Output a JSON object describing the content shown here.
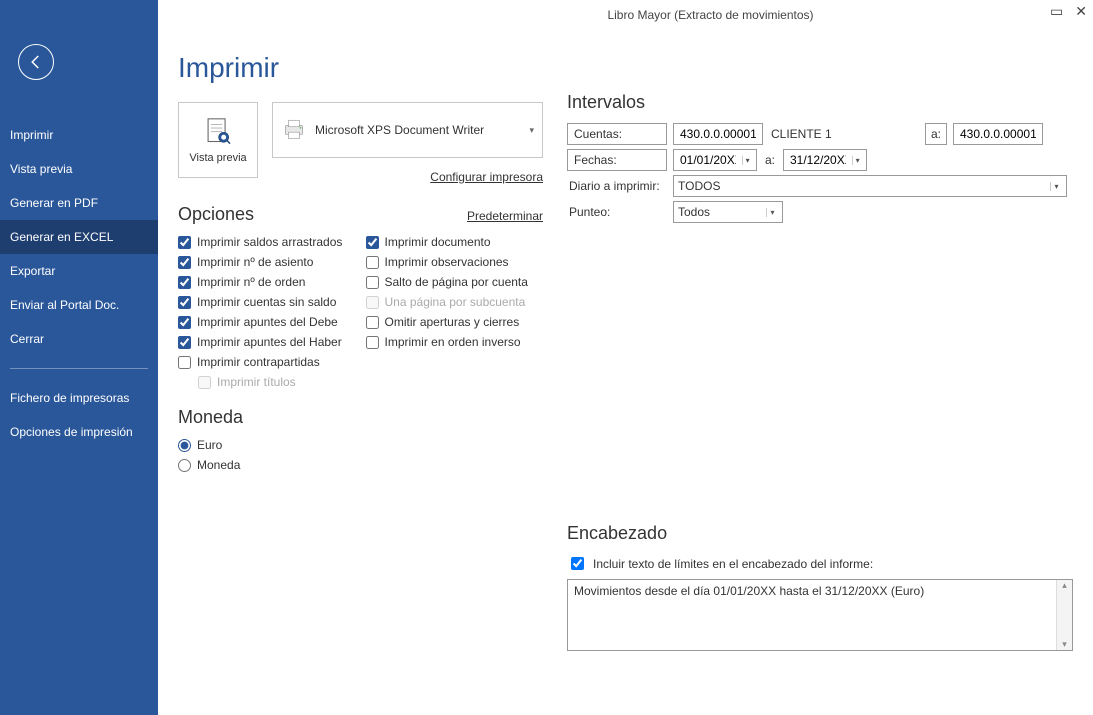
{
  "window": {
    "title": "Libro Mayor (Extracto de movimientos)"
  },
  "sidebar": {
    "items": [
      {
        "label": "Imprimir"
      },
      {
        "label": "Vista previa"
      },
      {
        "label": "Generar en PDF"
      },
      {
        "label": "Generar en EXCEL",
        "selected": true
      },
      {
        "label": "Exportar"
      },
      {
        "label": "Enviar al Portal Doc."
      },
      {
        "label": "Cerrar"
      }
    ],
    "items2": [
      {
        "label": "Fichero de impresoras"
      },
      {
        "label": "Opciones de impresión"
      }
    ]
  },
  "page": {
    "title": "Imprimir",
    "previewLabel": "Vista previa",
    "printerName": "Microsoft XPS Document Writer",
    "configurePrinter": "Configurar impresora",
    "optionsTitle": "Opciones",
    "defaultLink": "Predeterminar"
  },
  "options": {
    "left": [
      {
        "label": "Imprimir saldos arrastrados",
        "checked": true
      },
      {
        "label": "Imprimir nº de asiento",
        "checked": true
      },
      {
        "label": "Imprimir nº de orden",
        "checked": true
      },
      {
        "label": "Imprimir cuentas sin saldo",
        "checked": true
      },
      {
        "label": "Imprimir apuntes del Debe",
        "checked": true
      },
      {
        "label": "Imprimir apuntes del Haber",
        "checked": true
      },
      {
        "label": "Imprimir contrapartidas",
        "checked": false
      },
      {
        "label": "Imprimir títulos",
        "checked": false,
        "disabled": true,
        "indent": true
      }
    ],
    "right": [
      {
        "label": "Imprimir documento",
        "checked": true
      },
      {
        "label": "Imprimir observaciones",
        "checked": false
      },
      {
        "label": "Salto de página por cuenta",
        "checked": false
      },
      {
        "label": "Una página por subcuenta",
        "checked": false,
        "disabled": true
      },
      {
        "label": "Omitir aperturas y cierres",
        "checked": false
      },
      {
        "label": "Imprimir en orden inverso",
        "checked": false
      }
    ]
  },
  "moneda": {
    "title": "Moneda",
    "options": [
      {
        "label": "Euro",
        "checked": true
      },
      {
        "label": "Moneda",
        "checked": false
      }
    ]
  },
  "intervalos": {
    "title": "Intervalos",
    "cuentasLabel": "Cuentas:",
    "cuentaFrom": "430.0.0.00001",
    "cuentaFromName": "CLIENTE 1",
    "aLabel": "a:",
    "cuentaTo": "430.0.0.00001",
    "fechasLabel": "Fechas:",
    "fechaFrom": "01/01/20XX",
    "fechaTo": "31/12/20XX",
    "diarioLabel": "Diario a imprimir:",
    "diarioValue": "TODOS",
    "punteoLabel": "Punteo:",
    "punteoValue": "Todos"
  },
  "encabezado": {
    "title": "Encabezado",
    "includeLabel": "Incluir texto de límites en el encabezado del informe:",
    "includeChecked": true,
    "text": "Movimientos desde el día 01/01/20XX hasta el 31/12/20XX (Euro)"
  }
}
